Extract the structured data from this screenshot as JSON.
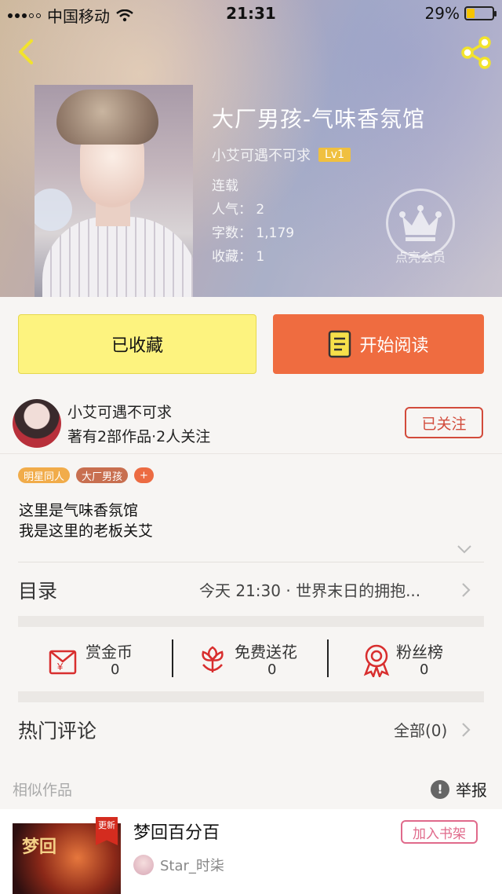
{
  "status_bar": {
    "carrier": "中国移动",
    "time": "21:31",
    "battery": "29%",
    "battery_level": 0.29
  },
  "header": {
    "back_icon": "chevron-left-icon",
    "share_icon": "share-icon"
  },
  "book": {
    "title": "大厂男孩-气味香氛馆",
    "author": "小艾可遇不可求",
    "level": "Lv1",
    "status": "连载",
    "popularity": "人气：  2",
    "word_count": "字数：  1,179",
    "collections": "收藏：  1",
    "vip_label": "点亮会员"
  },
  "actions": {
    "collected_label": "已收藏",
    "read_label": "开始阅读"
  },
  "author_row": {
    "name": "小艾可遇不可求",
    "works": "著有2部作品·2人关注",
    "follow_label": "已关注"
  },
  "tags": [
    "明星同人",
    "大厂男孩",
    "+"
  ],
  "description": {
    "line1": "这里是气味香氛馆",
    "line2": "我是这里的老板关艾"
  },
  "toc": {
    "label": "目录",
    "latest": "今天 21:30 · 世界末日的拥抱..."
  },
  "stats": [
    {
      "label": "赏金币",
      "value": "0",
      "icon": "red-envelope-icon"
    },
    {
      "label": "免费送花",
      "value": "0",
      "icon": "flower-icon"
    },
    {
      "label": "粉丝榜",
      "value": "0",
      "icon": "medal-icon"
    }
  ],
  "comments": {
    "label": "热门评论",
    "all_label": "全部(0)"
  },
  "similar": {
    "label": "相似作品",
    "report_label": "举报",
    "item": {
      "title": "梦回百分百",
      "author": "Star_时柒",
      "badge": "更新",
      "cover_text": "梦回",
      "add_label": "加入书架"
    }
  },
  "colors": {
    "collected_bg": "#fdf37f",
    "read_bg": "#ef6c40",
    "follow": "#d24b3b",
    "tag_star": "#f1ac4a",
    "tag_factory": "#c86f50",
    "add_shelf": "#e06a8b"
  }
}
